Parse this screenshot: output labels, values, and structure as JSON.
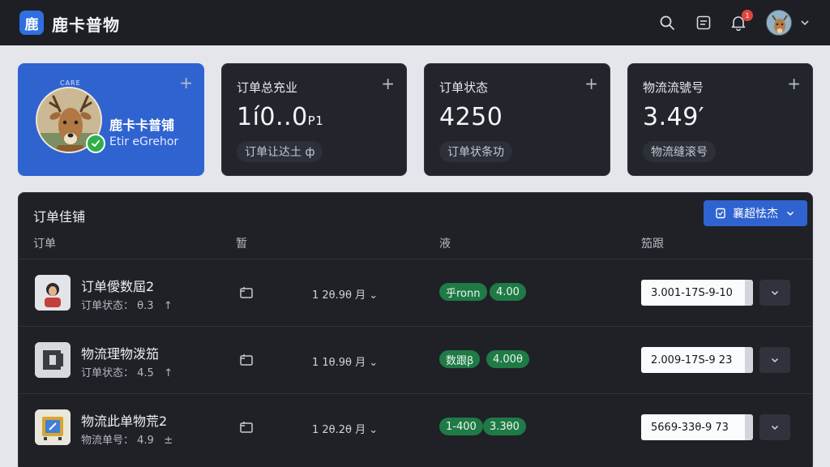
{
  "app": {
    "logo_char": "鹿",
    "title": "鹿卡普物"
  },
  "header": {
    "notification_count": "1"
  },
  "profile_card": {
    "caption": "CARE",
    "name": "鹿卡卡普铺",
    "subtitle": "Etir eGrehor"
  },
  "stat_cards": [
    {
      "title": "订单总充业",
      "value": "1í0..0",
      "value_suffix": "P1",
      "sub": "订单让达土 ф"
    },
    {
      "title": "订单状态",
      "value": "4250",
      "value_suffix": "",
      "sub": "订单状条功"
    },
    {
      "title": "物流流號号",
      "value": "3.49′",
      "value_suffix": "",
      "sub": "物流缝滚号"
    }
  ],
  "panel": {
    "title": "订单佳铺",
    "button_label": "襄超怯杰",
    "columns": [
      "订单",
      "暂",
      "液",
      "笳跟"
    ]
  },
  "rows": [
    {
      "title": "订单僾数屆2",
      "sub": "订单状态：",
      "sub_value": "θ.3",
      "arrow": "↑",
      "time": "1 2θ.9θ 月",
      "pills": [
        "乎ronn",
        "4.00"
      ],
      "code": "3.001-17S-9-10"
    },
    {
      "title": "物流理物泼笳",
      "sub": "订单状态：",
      "sub_value": "4.5",
      "arrow": "↑",
      "time": "1 1θ.9θ 月",
      "pills": [
        "数跟β",
        "4.00θ"
      ],
      "code": "2.009-17S-9 23"
    },
    {
      "title": "物流此单物荒2",
      "sub": "物流单号：",
      "sub_value": "4.9",
      "arrow": "±",
      "time": "1 2θ.2θ 月",
      "pills": [
        "1-400",
        "3.3θ0"
      ],
      "code": "5669-33θ-9 73"
    }
  ],
  "colors": {
    "accent": "#2f63d0",
    "pill_green": "#1f7a46",
    "badge_red": "#e0463e"
  }
}
